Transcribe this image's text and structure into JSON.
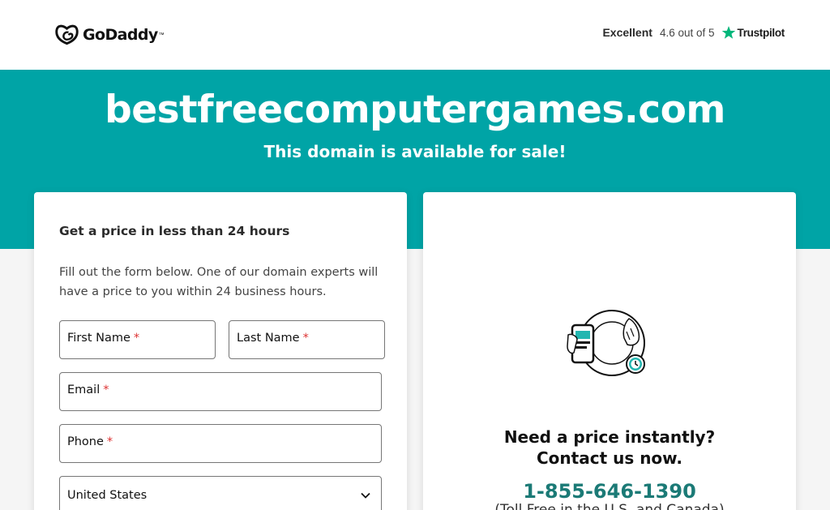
{
  "header": {
    "brand": "GoDaddy",
    "brand_mark": "godaddy-logo-icon",
    "rating_word": "Excellent",
    "rating_score": "4.6 out of 5",
    "trustpilot_label": "Trustpilot",
    "trustpilot_icon": "star-icon",
    "trustpilot_color": "#00b67a"
  },
  "hero": {
    "domain": "bestfreecomputergames.com",
    "subtitle": "This domain is available for sale!",
    "background": "#00a4a6"
  },
  "form": {
    "heading": "Get a price in less than 24 hours",
    "description": "Fill out the form below. One of our domain experts will have a price to you within 24 business hours.",
    "required_marker": "*",
    "fields": {
      "first_name": "First Name",
      "last_name": "Last Name",
      "email": "Email",
      "phone": "Phone",
      "country": "United States"
    }
  },
  "contact": {
    "illustration": "phone-and-clock-illustration",
    "line1": "Need a price instantly?",
    "line2": "Contact us now.",
    "phone": "1-855-646-1390",
    "note": "(Toll Free in the U.S. and Canada)",
    "accent": "#1b7a76"
  }
}
